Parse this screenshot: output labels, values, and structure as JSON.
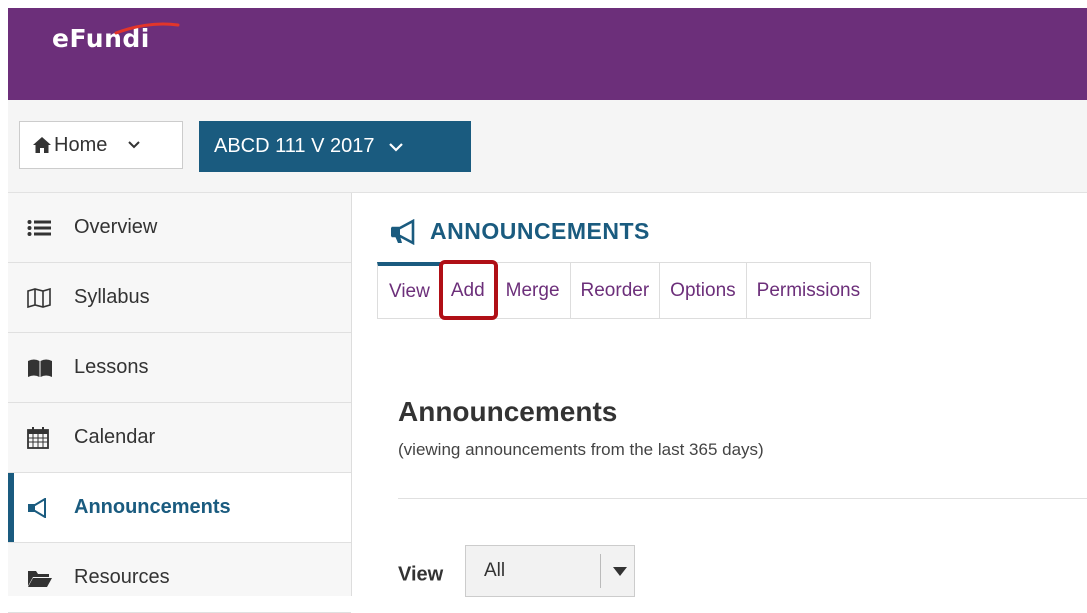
{
  "header": {
    "logo_text": "eFundi",
    "brand_color": "#6c2f7a"
  },
  "nav": {
    "home_label": "Home",
    "site_label": "ABCD 111 V 2017",
    "site_color": "#1a5b7f"
  },
  "sidebar": {
    "items": [
      {
        "label": "Overview",
        "icon": "list-icon"
      },
      {
        "label": "Syllabus",
        "icon": "map-icon"
      },
      {
        "label": "Lessons",
        "icon": "book-icon"
      },
      {
        "label": "Calendar",
        "icon": "calendar-icon"
      },
      {
        "label": "Announcements",
        "icon": "megaphone-icon",
        "active": true
      },
      {
        "label": "Resources",
        "icon": "folder-icon"
      }
    ]
  },
  "tool": {
    "title": "ANNOUNCEMENTS",
    "tabs": [
      "View",
      "Add",
      "Merge",
      "Reorder",
      "Options",
      "Permissions"
    ],
    "highlighted_tab": "Add",
    "highlight_color": "#b00f16"
  },
  "content": {
    "heading": "Announcements",
    "subtitle": "(viewing announcements from the last 365 days)",
    "view_label": "View",
    "view_selected": "All"
  }
}
